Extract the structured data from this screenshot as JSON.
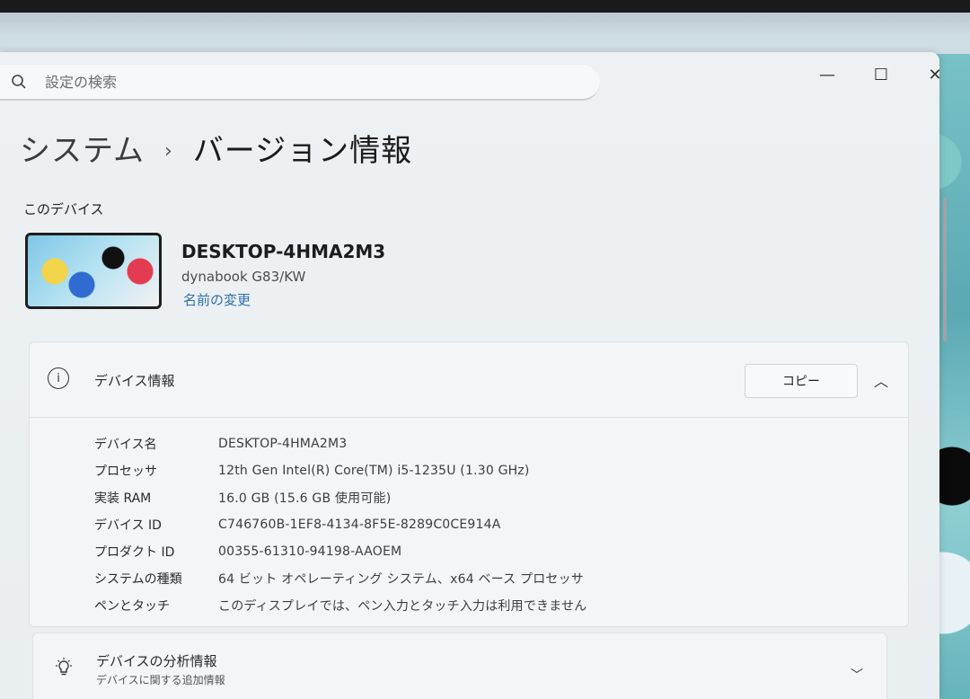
{
  "search": {
    "placeholder": "設定の検索"
  },
  "window_controls": {
    "minimize": "—",
    "maximize": "☐",
    "close": "✕"
  },
  "breadcrumb": {
    "parent": "システム",
    "separator": "›",
    "current": "バージョン情報"
  },
  "device_section": {
    "label": "このデバイス",
    "name": "DESKTOP-4HMA2M3",
    "model": "dynabook G83/KW",
    "rename_link": "名前の変更"
  },
  "device_info": {
    "title": "デバイス情報",
    "copy_label": "コピー",
    "rows": [
      {
        "label": "デバイス名",
        "value": "DESKTOP-4HMA2M3"
      },
      {
        "label": "プロセッサ",
        "value": "12th Gen Intel(R) Core(TM) i5-1235U (1.30 GHz)"
      },
      {
        "label": "実装 RAM",
        "value": "16.0 GB (15.6 GB 使用可能)"
      },
      {
        "label": "デバイス ID",
        "value": "C746760B-1EF8-4134-8F5E-8289C0CE914A"
      },
      {
        "label": "プロダクト ID",
        "value": "00355-61310-94198-AAOEM"
      },
      {
        "label": "システムの種類",
        "value": "64 ビット オペレーティング システム、x64 ベース プロセッサ"
      },
      {
        "label": "ペンとタッチ",
        "value": "このディスプレイでは、ペン入力とタッチ入力は利用できません"
      }
    ]
  },
  "diagnostics": {
    "title": "デバイスの分析情報",
    "subtitle": "デバイスに関する追加情報"
  },
  "colors": {
    "accent_link": "#2e6fb0",
    "card_bg": "#f3f5f6",
    "window_bg": "#edf1f3"
  }
}
